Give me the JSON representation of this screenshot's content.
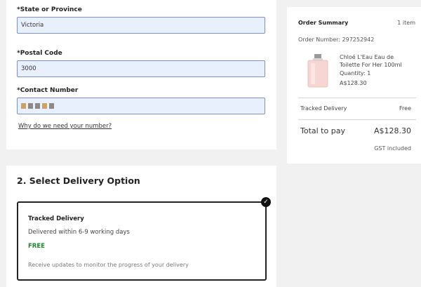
{
  "address": {
    "state_label": "*State or Province",
    "state_value": "Victoria",
    "postal_label": "*Postal Code",
    "postal_value": "3000",
    "contact_label": "*Contact Number",
    "why_link": "Why do we need your number?"
  },
  "delivery": {
    "section_title": "2. Select Delivery Option",
    "option": {
      "title": "Tracked Delivery",
      "description": "Delivered within 6-9 working days",
      "price": "FREE",
      "note": "Receive updates to monitor the progress of your delivery",
      "selected": true
    }
  },
  "summary": {
    "title": "Order Summary",
    "item_count": "1 item",
    "order_number_label": "Order Number:",
    "order_number": "297252942",
    "product": {
      "name": "Chloé L'Eau Eau de Toilette For Her 100ml",
      "quantity": "Quantity: 1",
      "price": "A$128.30"
    },
    "shipping_label": "Tracked Delivery",
    "shipping_value": "Free",
    "total_label": "Total to pay",
    "total_value": "A$128.30",
    "gst_note": "GST included"
  },
  "colors": {
    "accent_free": "#1a8a2a",
    "input_bg": "#e8f0fe",
    "input_border": "#7c93c9"
  }
}
